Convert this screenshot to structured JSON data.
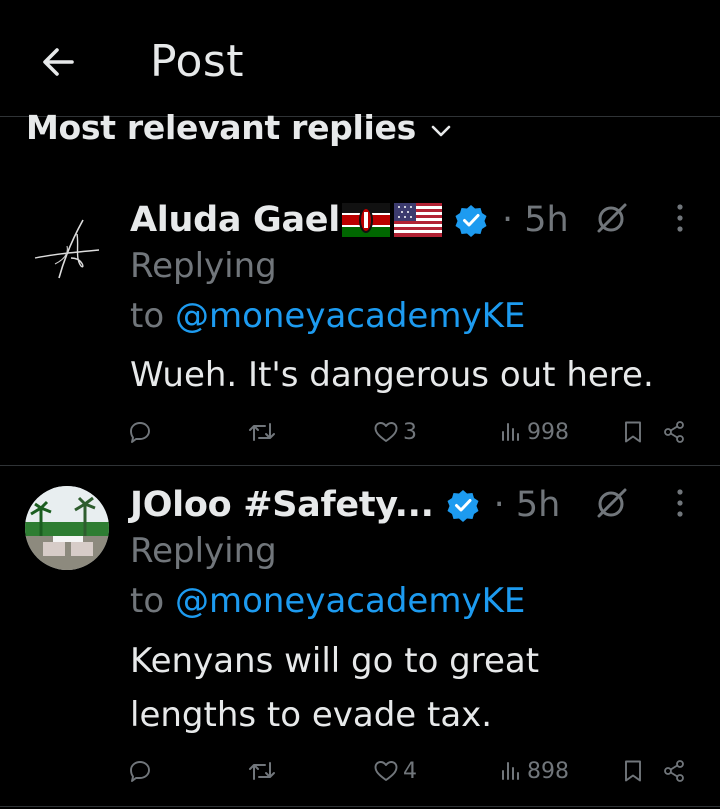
{
  "header": {
    "title": "Post",
    "back_icon": "arrow-left-icon"
  },
  "sort": {
    "label": "Most relevant replies",
    "icon": "chevron-down-icon"
  },
  "colors": {
    "background": "#000000",
    "text": "#e7e9ea",
    "muted": "#71767b",
    "link": "#1d9bf0",
    "verified": "#1d9bf0"
  },
  "replies": [
    {
      "author": "Aluda Gael",
      "flags": [
        "kenya-flag",
        "usa-flag"
      ],
      "time": "5h",
      "replying_prefix": "Replying",
      "replying_to": "to",
      "handle": "@moneyacademyKE",
      "text": "Wueh. It's dangerous out here.",
      "likes": "3",
      "views": "998"
    },
    {
      "author": "JOloo #Safety...",
      "flags": [],
      "time": "5h",
      "replying_prefix": "Replying",
      "replying_to": "to",
      "handle": "@moneyacademyKE",
      "text_line1": "Kenyans will go to great",
      "text_line2": "lengths to evade tax.",
      "likes": "4",
      "views": "898"
    }
  ]
}
